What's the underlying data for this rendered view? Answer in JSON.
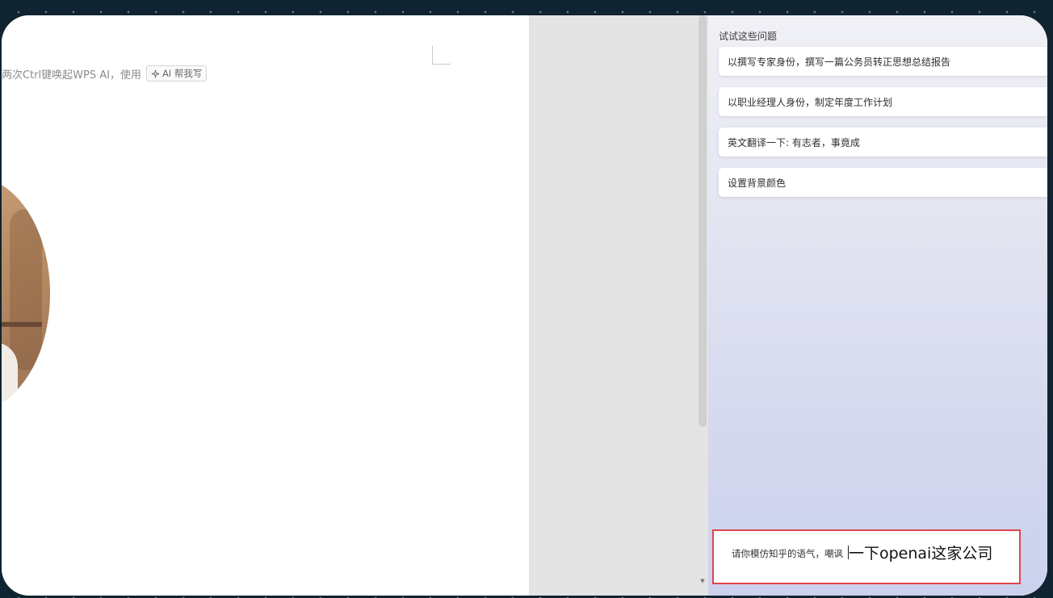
{
  "document": {
    "hint_text": "两次Ctrl键唤起WPS AI，使用",
    "ai_chip_label": "AI 帮我写"
  },
  "ai_panel": {
    "title": "试试这些问题",
    "suggestions": [
      "以撰写专家身份，撰写一篇公务员转正思想总结报告",
      "以职业经理人身份，制定年度工作计划",
      "英文翻译一下: 有志者，事竟成",
      "设置背景颜色"
    ],
    "input": {
      "typed_text": "请你模仿知乎的语气，嘲讽",
      "composing_text": "一下openai这家公司"
    }
  },
  "colors": {
    "highlight_border": "#e0454b",
    "frame_background": "#0f2430"
  },
  "icons": [
    "sparkle-icon",
    "scroll-down-arrow-icon"
  ]
}
